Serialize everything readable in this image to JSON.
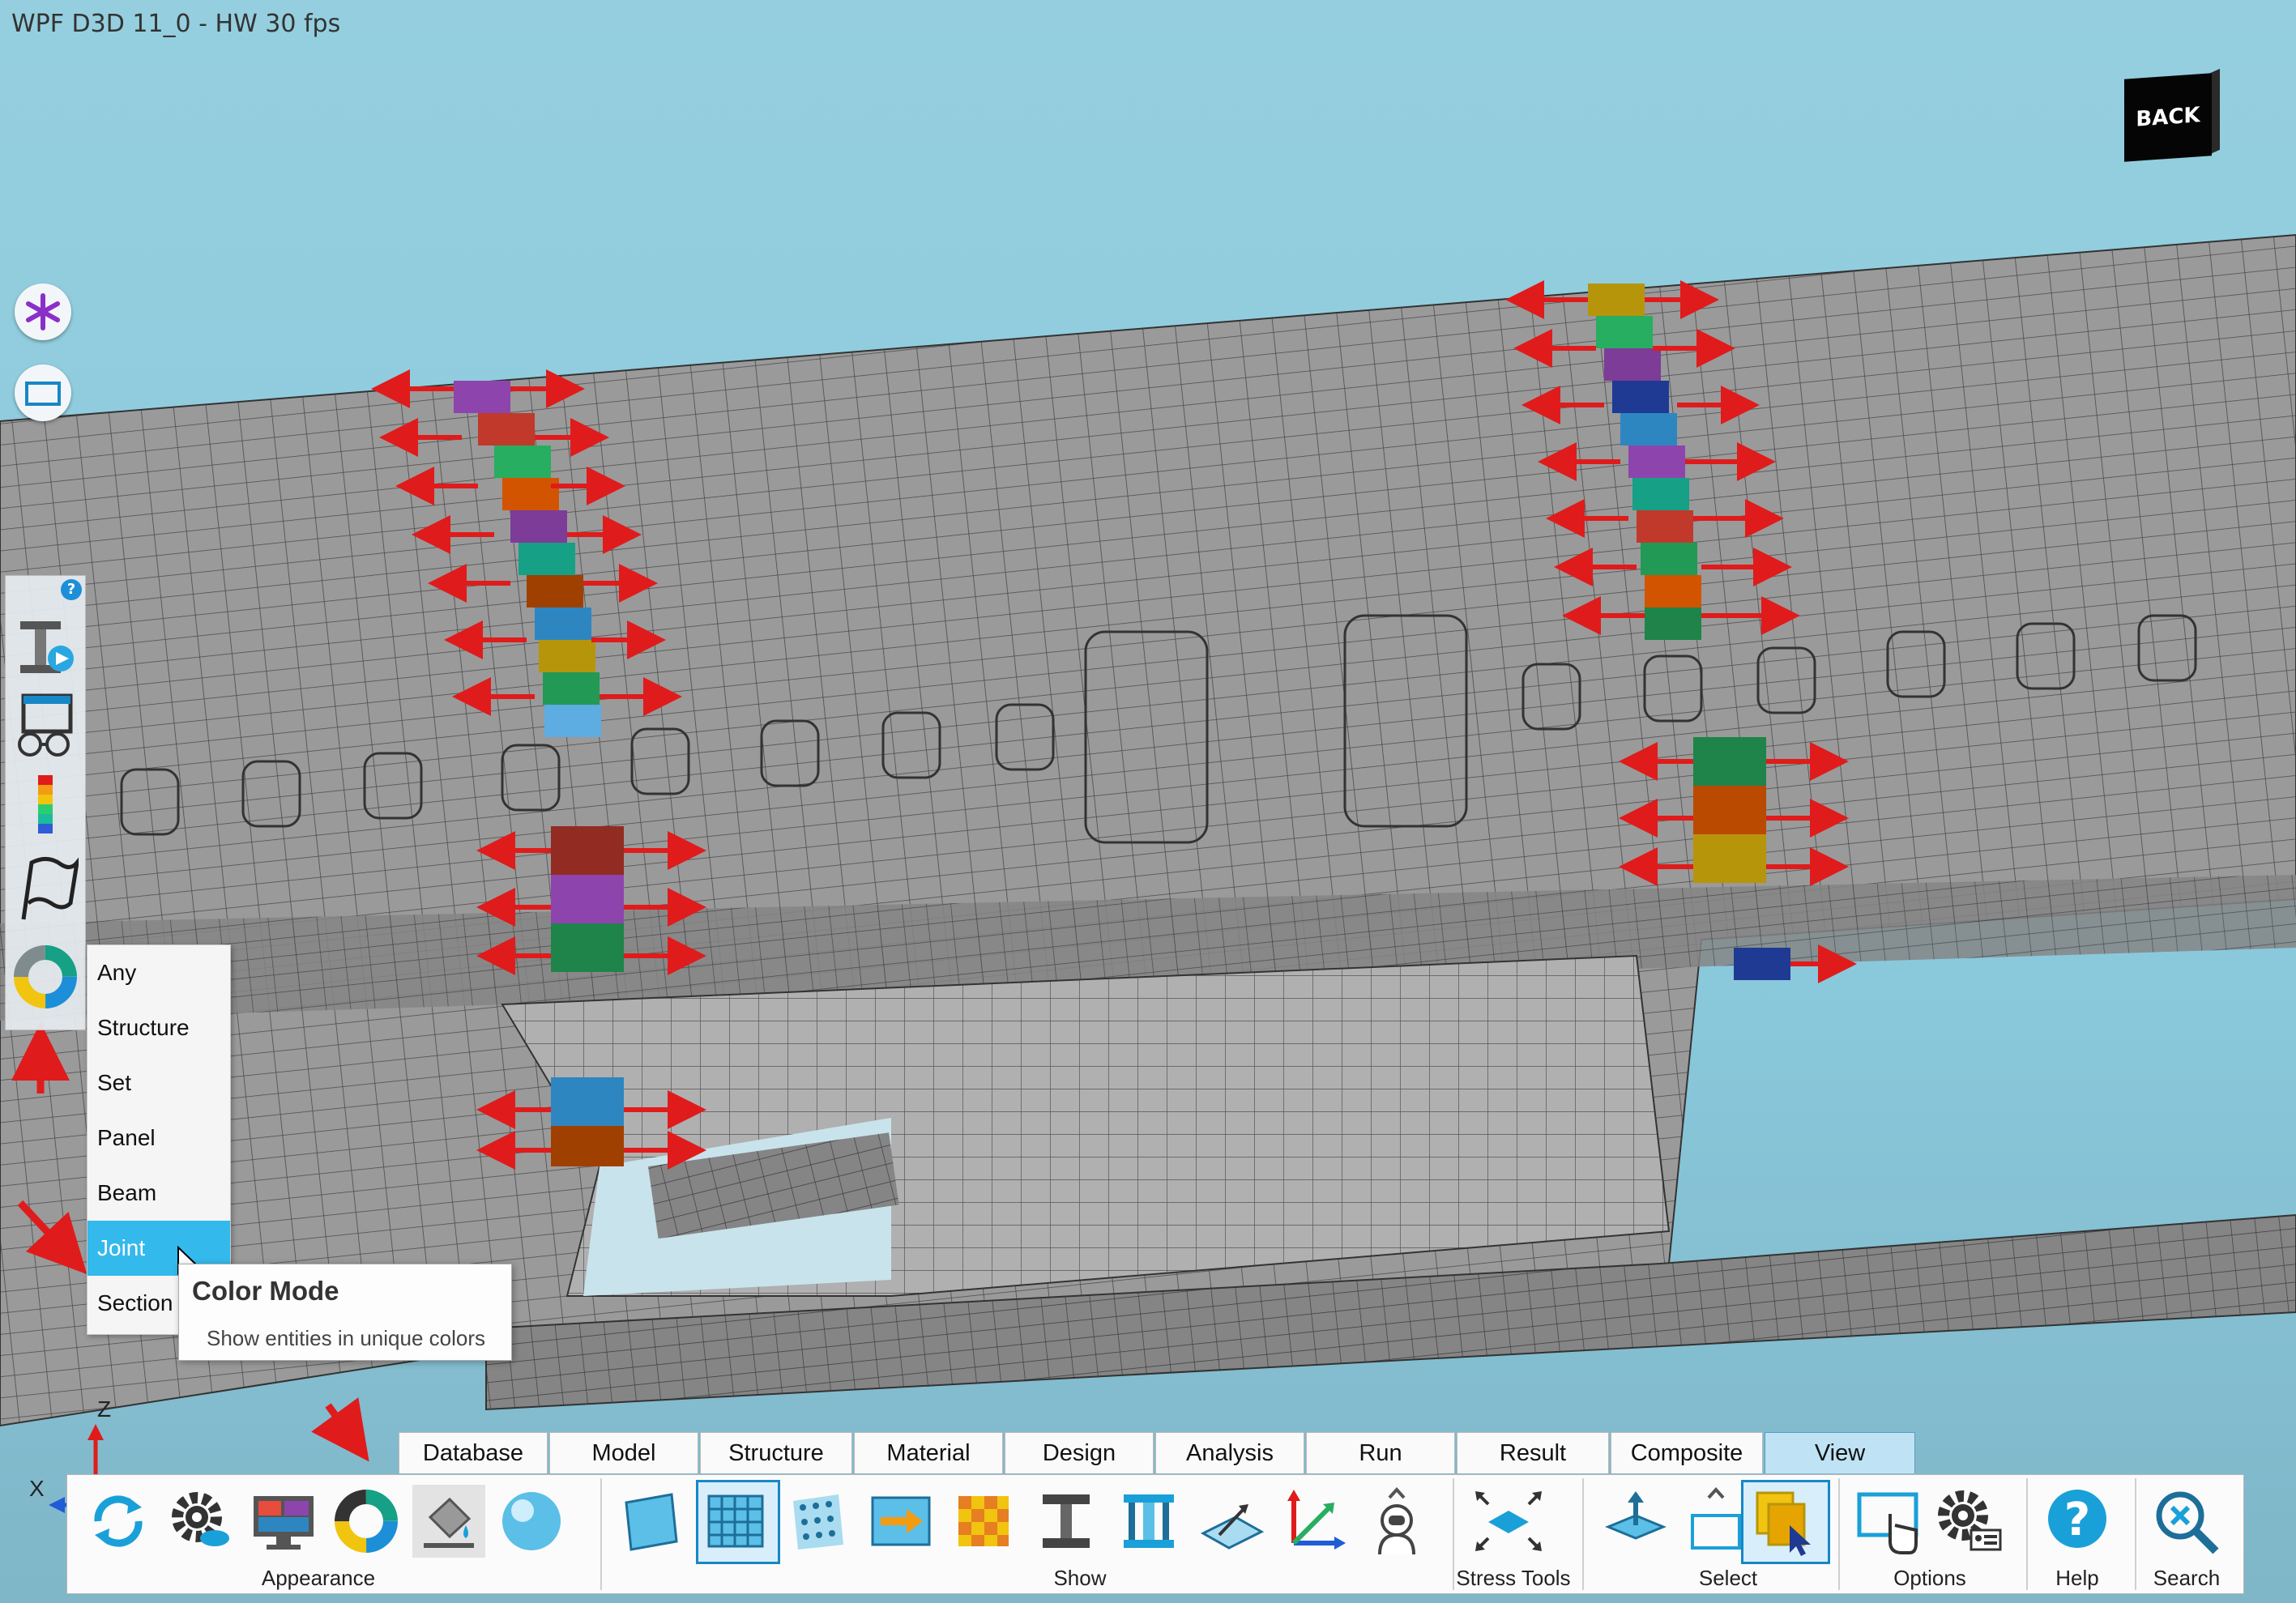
{
  "window": {
    "title": "WPF D3D 11_0 - HW  30 fps"
  },
  "navcube": {
    "face_label": "BACK"
  },
  "colors": {
    "accent": "#34b9ec",
    "arrow": "#e01b1b",
    "sky": "#8ecde0",
    "tab_active": "#bfe3f5"
  },
  "left_buttons": [
    {
      "icon": "asterisk-icon"
    },
    {
      "icon": "rectangle-select-icon"
    }
  ],
  "side_toolbar": {
    "help": "?",
    "tools": [
      {
        "icon": "section-beam-play-icon"
      },
      {
        "icon": "glasses-view-icon"
      },
      {
        "icon": "color-scale-icon"
      },
      {
        "icon": "flag-icon"
      },
      {
        "icon": "color-mode-wheel-icon"
      }
    ]
  },
  "color_menu": {
    "items": [
      "Any",
      "Structure",
      "Set",
      "Panel",
      "Beam",
      "Joint",
      "Section"
    ],
    "selected": "Joint"
  },
  "tooltip": {
    "title": "Color Mode",
    "description": "Show entities in unique colors"
  },
  "axes": {
    "x": "X",
    "z": "Z"
  },
  "tabs": [
    {
      "label": "Database"
    },
    {
      "label": "Model"
    },
    {
      "label": "Structure"
    },
    {
      "label": "Material"
    },
    {
      "label": "Design"
    },
    {
      "label": "Analysis"
    },
    {
      "label": "Run"
    },
    {
      "label": "Result"
    },
    {
      "label": "Composite"
    },
    {
      "label": "View"
    }
  ],
  "active_tab": "View",
  "ribbon": {
    "groups": {
      "appearance": "Appearance",
      "show": "Show",
      "stress_tools": "Stress Tools",
      "select": "Select",
      "options": "Options",
      "help": "Help",
      "search": "Search"
    }
  }
}
